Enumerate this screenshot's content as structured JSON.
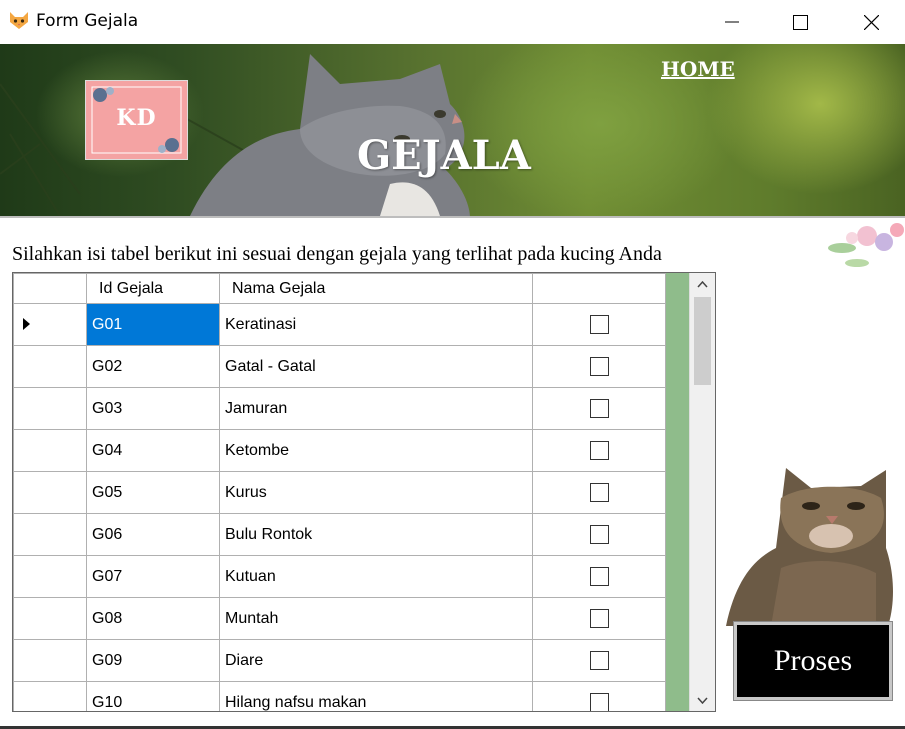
{
  "window": {
    "title": "Form Gejala",
    "icon": "cat-face-icon",
    "controls": {
      "minimize": "minimize-icon",
      "maximize": "maximize-icon",
      "close": "close-icon"
    }
  },
  "banner": {
    "logo_text": "KD",
    "home_link": "HOME",
    "title": "GEJALA"
  },
  "instruction": "Silahkan isi tabel berikut ini sesuai dengan gejala yang terlihat pada kucing Anda",
  "grid": {
    "columns": [
      "Id Gejala",
      "Nama Gejala",
      ""
    ],
    "rows": [
      {
        "id": "G01",
        "nama": "Keratinasi",
        "checked": false
      },
      {
        "id": "G02",
        "nama": "Gatal - Gatal",
        "checked": false
      },
      {
        "id": "G03",
        "nama": "Jamuran",
        "checked": false
      },
      {
        "id": "G04",
        "nama": "Ketombe",
        "checked": false
      },
      {
        "id": "G05",
        "nama": "Kurus",
        "checked": false
      },
      {
        "id": "G06",
        "nama": "Bulu Rontok",
        "checked": false
      },
      {
        "id": "G07",
        "nama": "Kutuan",
        "checked": false
      },
      {
        "id": "G08",
        "nama": "Muntah",
        "checked": false
      },
      {
        "id": "G09",
        "nama": "Diare",
        "checked": false
      },
      {
        "id": "G10",
        "nama": "Hilang nafsu makan",
        "checked": false
      }
    ],
    "selected_row": 0,
    "background_color": "#8fbc8b",
    "selection_color": "#0078d7"
  },
  "proses_button": "Proses"
}
